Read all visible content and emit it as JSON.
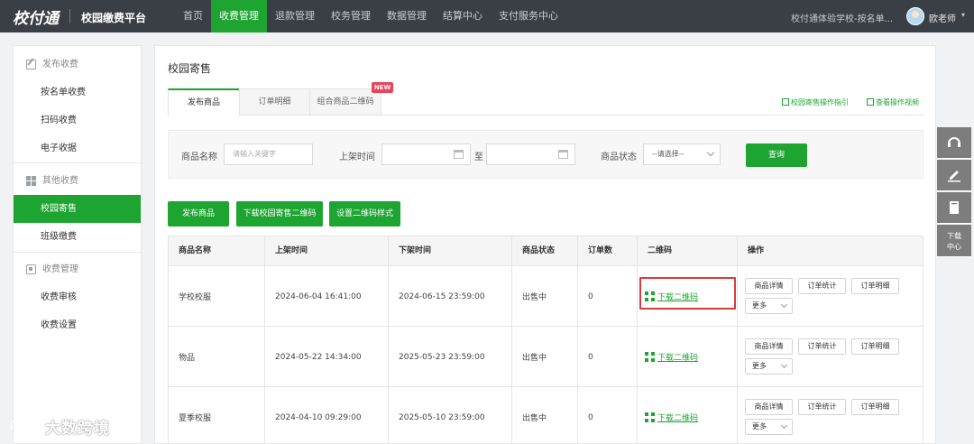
{
  "header": {
    "logo": "校付通",
    "platform": "校园缴费平台",
    "nav": [
      "首页",
      "收费管理",
      "退款管理",
      "校务管理",
      "数据管理",
      "结算中心",
      "支付服务中心"
    ],
    "active_nav": "收费管理",
    "school": "校付通体验学校-按名单...",
    "user": "欧老师",
    "user_caret": "▾"
  },
  "sidebar": {
    "groups": [
      {
        "label": "发布收费",
        "icon": "edit-icon",
        "items": [
          "按名单收费",
          "扫码收费",
          "电子收据"
        ]
      },
      {
        "label": "其他收费",
        "icon": "grid-icon",
        "items": [
          "校园寄售",
          "班级缴费"
        ]
      },
      {
        "label": "收费管理",
        "icon": "box-icon",
        "items": [
          "收费审核",
          "收费设置"
        ]
      }
    ],
    "active_item": "校园寄售"
  },
  "main": {
    "title": "校园寄售",
    "tabs": [
      "发布商品",
      "订单明细",
      "组合商品二维码"
    ],
    "active_tab": "发布商品",
    "new_badge": "NEW",
    "links": [
      "校园寄售操作指引",
      "查看操作视频"
    ]
  },
  "search": {
    "name_label": "商品名称",
    "name_placeholder": "请输入关键字",
    "time_label": "上架时间",
    "to_label": "至",
    "status_label": "商品状态",
    "status_value": "--请选择--",
    "query_button": "查询"
  },
  "actions": [
    "发布商品",
    "下载校园寄售二维码",
    "设置二维码样式"
  ],
  "table": {
    "columns": [
      "商品名称",
      "上架时间",
      "下架时间",
      "商品状态",
      "订单数",
      "二维码",
      "操作"
    ],
    "rows": [
      {
        "name": "学校校服",
        "on": "2024-06-04 16:41:00",
        "off": "2024-06-15 23:59:00",
        "status": "出售中",
        "orders": "0",
        "qr": "下载二维码"
      },
      {
        "name": "物品",
        "on": "2024-05-22 14:34:00",
        "off": "2025-05-23 23:59:00",
        "status": "出售中",
        "orders": "0",
        "qr": "下载二维码"
      },
      {
        "name": "夏季校服",
        "on": "2024-04-10 09:29:00",
        "off": "2025-05-10 23:59:00",
        "status": "出售中",
        "orders": "0",
        "qr": "下载二维码"
      }
    ],
    "op_buttons": [
      "商品详情",
      "订单统计",
      "订单明细"
    ],
    "more": "更多"
  },
  "float": {
    "download": "下载中心"
  },
  "watermark": "大数跨境",
  "colors": {
    "brand_green": "#1ea431",
    "topbar": "#3a3f45",
    "highlight": "#d83b3b",
    "badge": "#e8445a"
  }
}
